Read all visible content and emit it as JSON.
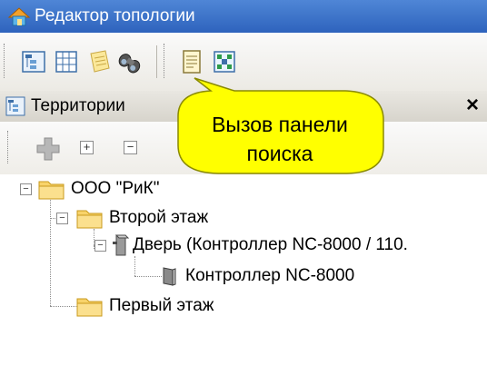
{
  "window": {
    "title": "Редактор топологии",
    "title_color": "#ffffff",
    "titlebar_color": "#3a6fc8"
  },
  "toolbar": {
    "buttons": [
      {
        "name": "territories-view-button",
        "icon": "tree-view-icon"
      },
      {
        "name": "grid-view-button",
        "icon": "grid-icon"
      },
      {
        "name": "notes-button",
        "icon": "note-icon"
      },
      {
        "name": "search-panel-button",
        "icon": "binoculars-icon"
      },
      {
        "name": "document-button",
        "icon": "document-icon"
      },
      {
        "name": "matrix-button",
        "icon": "matrix-icon"
      }
    ]
  },
  "panel": {
    "title": "Территории",
    "close_label": "×",
    "toolbar": [
      {
        "name": "add-button",
        "icon": "plus-icon"
      },
      {
        "name": "expand-all-button",
        "icon": "expand-icon"
      },
      {
        "name": "collapse-all-button",
        "icon": "collapse-icon"
      }
    ]
  },
  "callout": {
    "line1": "Вызов панели",
    "line2": "поиска",
    "fill_color": "#ffff00"
  },
  "tree": {
    "nodes": [
      {
        "label": "ООО \"РиК\"",
        "type": "folder",
        "expanded": true,
        "level": 0
      },
      {
        "label": "Второй этаж",
        "type": "folder",
        "expanded": true,
        "level": 1
      },
      {
        "label": "Дверь (Контроллер NC-8000 / 110.",
        "type": "door",
        "expanded": true,
        "level": 2
      },
      {
        "label": "Контроллер NC-8000",
        "type": "controller",
        "level": 3
      },
      {
        "label": "Первый этаж",
        "type": "folder",
        "level": 1
      }
    ]
  }
}
